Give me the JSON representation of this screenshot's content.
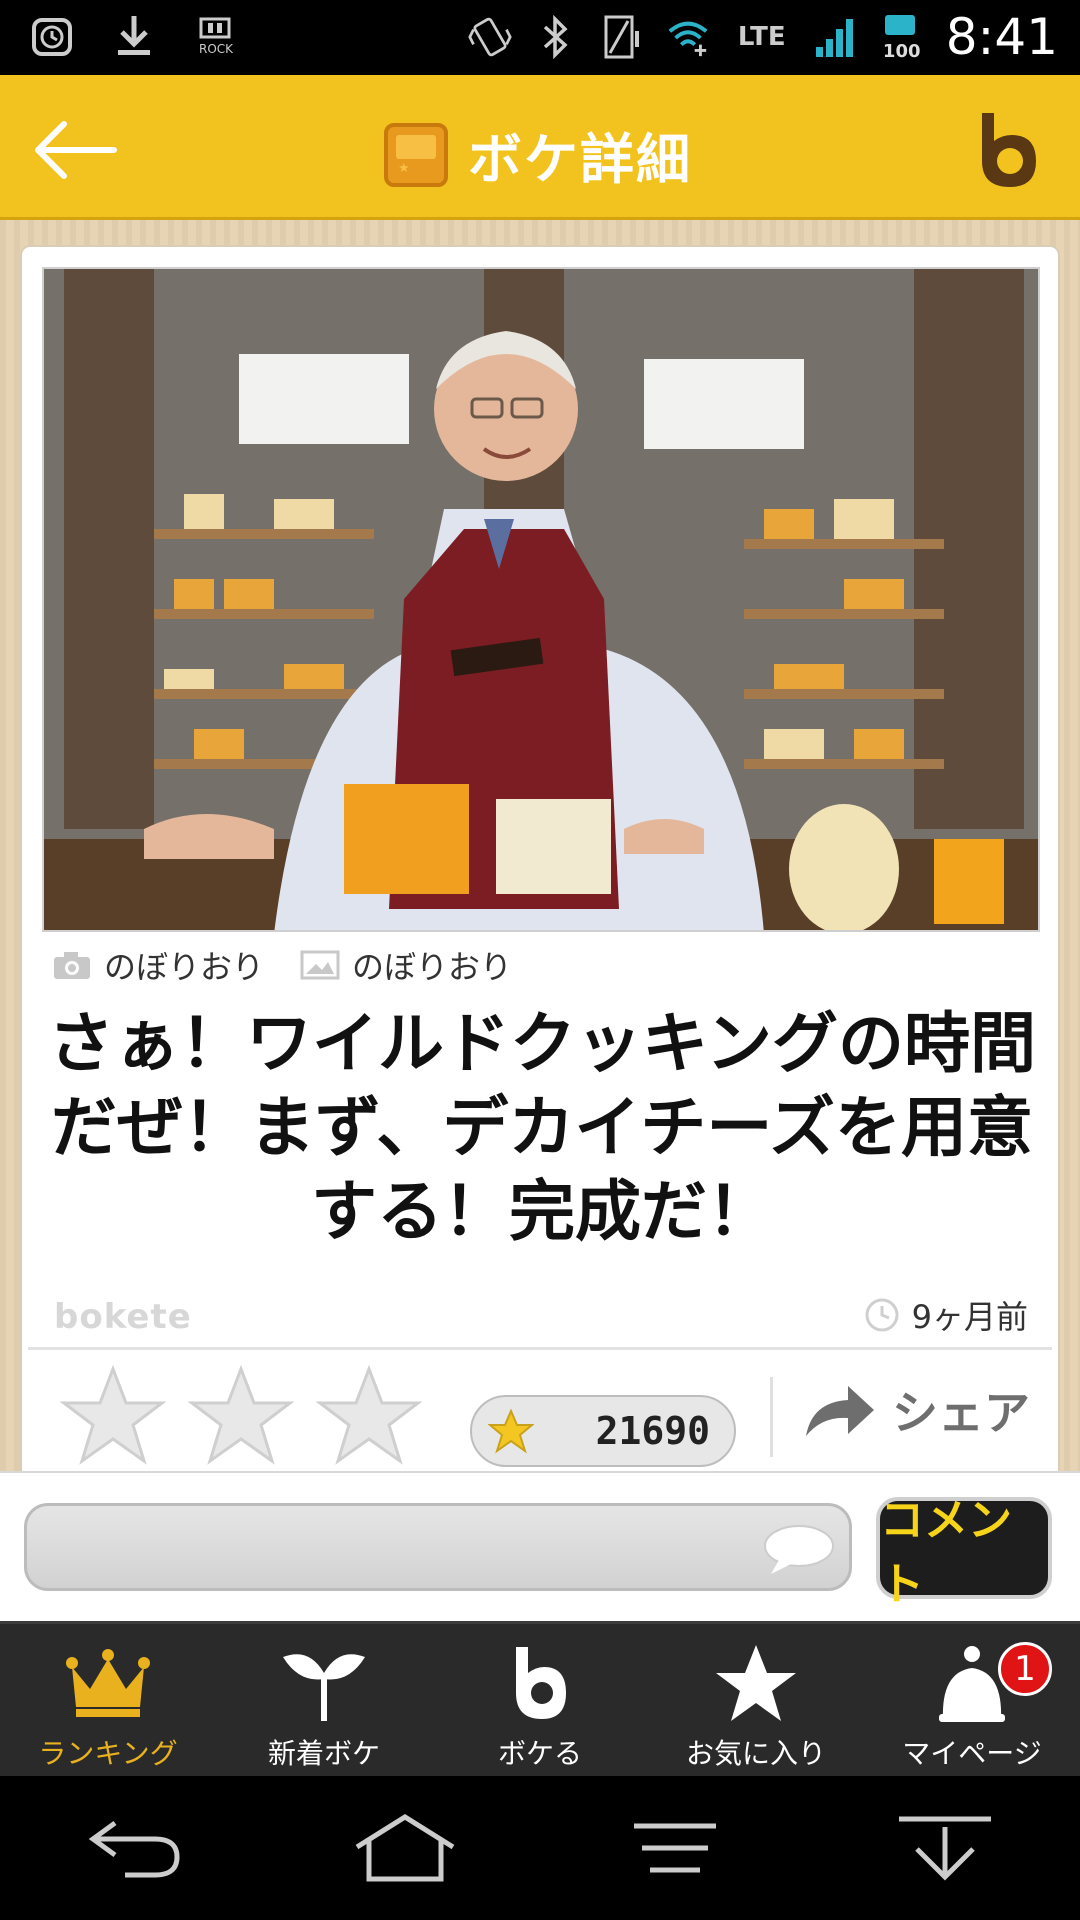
{
  "status_bar": {
    "rock_label": "ROCK",
    "network": "LTE",
    "battery": "100",
    "time": "8:41"
  },
  "header": {
    "title": "ボケ詳細",
    "accent_color": "#f2c31e"
  },
  "post": {
    "photographer": "のぼりおり",
    "uploader": "のぼりおり",
    "caption": "さぁ！ワイルドクッキングの時間だぜ！まず、デカイチーズを用意する！完成だ！",
    "watermark": "bokete",
    "time_ago": "9ヶ月前",
    "star_count": "21690",
    "share_label": "シェア"
  },
  "comment": {
    "placeholder": "",
    "button_label": "コメント"
  },
  "bottom_nav": {
    "items": [
      {
        "label": "ランキング",
        "icon": "crown-icon"
      },
      {
        "label": "新着ボケ",
        "icon": "sprout-icon"
      },
      {
        "label": "ボケる",
        "icon": "b-logo-icon"
      },
      {
        "label": "お気に入り",
        "icon": "star-icon"
      },
      {
        "label": "マイページ",
        "icon": "user-icon",
        "badge": "1"
      }
    ]
  }
}
